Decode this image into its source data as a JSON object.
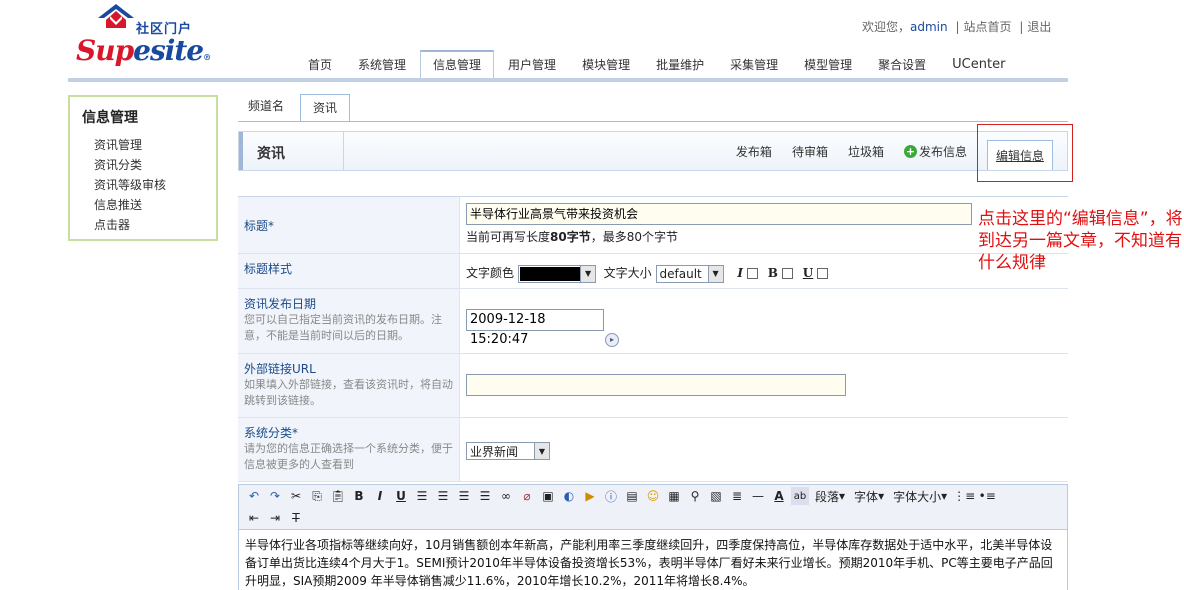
{
  "logo": {
    "cn": "社区门户",
    "en_left": "Sup",
    "en_right": "esite",
    "reg": "®"
  },
  "top": {
    "welcome": "欢迎您，",
    "user": "admin",
    "sep1": "|",
    "home": "站点首页",
    "sep2": "|",
    "logout": "退出"
  },
  "nav": [
    "首页",
    "系统管理",
    "信息管理",
    "用户管理",
    "模块管理",
    "批量维护",
    "采集管理",
    "模型管理",
    "聚合设置",
    "UCenter"
  ],
  "sidebar": {
    "heading": "信息管理",
    "items": [
      "资讯管理",
      "资讯分类",
      "资讯等级审核",
      "信息推送",
      "点击器"
    ]
  },
  "subtabs": [
    "频道名",
    "资讯"
  ],
  "panel": {
    "title": "资讯",
    "links": [
      "发布箱",
      "待审箱",
      "垃圾箱",
      "发布信息",
      "编辑信息"
    ]
  },
  "form": {
    "title": {
      "label": "标题*",
      "value": "半导体行业高景气带来投资机会",
      "hint_a": "当前可再写长度",
      "hint_num": "80字节",
      "hint_b": "，最多80个字节"
    },
    "style": {
      "label": "标题样式",
      "color_label": "文字颜色",
      "size_label": "文字大小",
      "size_value": "default",
      "italic": "I",
      "bold": "B",
      "underline": "U"
    },
    "date": {
      "label": "资讯发布日期",
      "desc": "您可以自己指定当前资讯的发布日期。注意，不能是当前时间以后的日期。",
      "value": "2009-12-18 15:20:47"
    },
    "url": {
      "label": "外部链接URL",
      "desc": "如果填入外部链接，查看该资讯时，将自动跳转到该链接。",
      "value": ""
    },
    "category": {
      "label": "系统分类*",
      "desc": "请为您的信息正确选择一个系统分类，便于信息被更多的人查看到",
      "value": "业界新闻"
    }
  },
  "toolbar": {
    "paragraph": "段落",
    "font": "字体",
    "fontsize": "字体大小"
  },
  "content": "半导体行业各项指标等继续向好，10月销售额创本年新高，产能利用率三季度继续回升，四季度保持高位，半导体库存数据处于适中水平，北美半导体设备订单出货比连续4个月大于1。SEMI预计2010年半导体设备投资增长53%，表明半导体厂看好未来行业增长。预期2010年手机、PC等主要电子产品回升明显，SIA预期2009 年半导体销售减少11.6%，2010年增长10.2%，2011年将增长8.4%。",
  "annotation": "点击这里的“编辑信息”，将到达另一篇文章，不知道有什么规律"
}
